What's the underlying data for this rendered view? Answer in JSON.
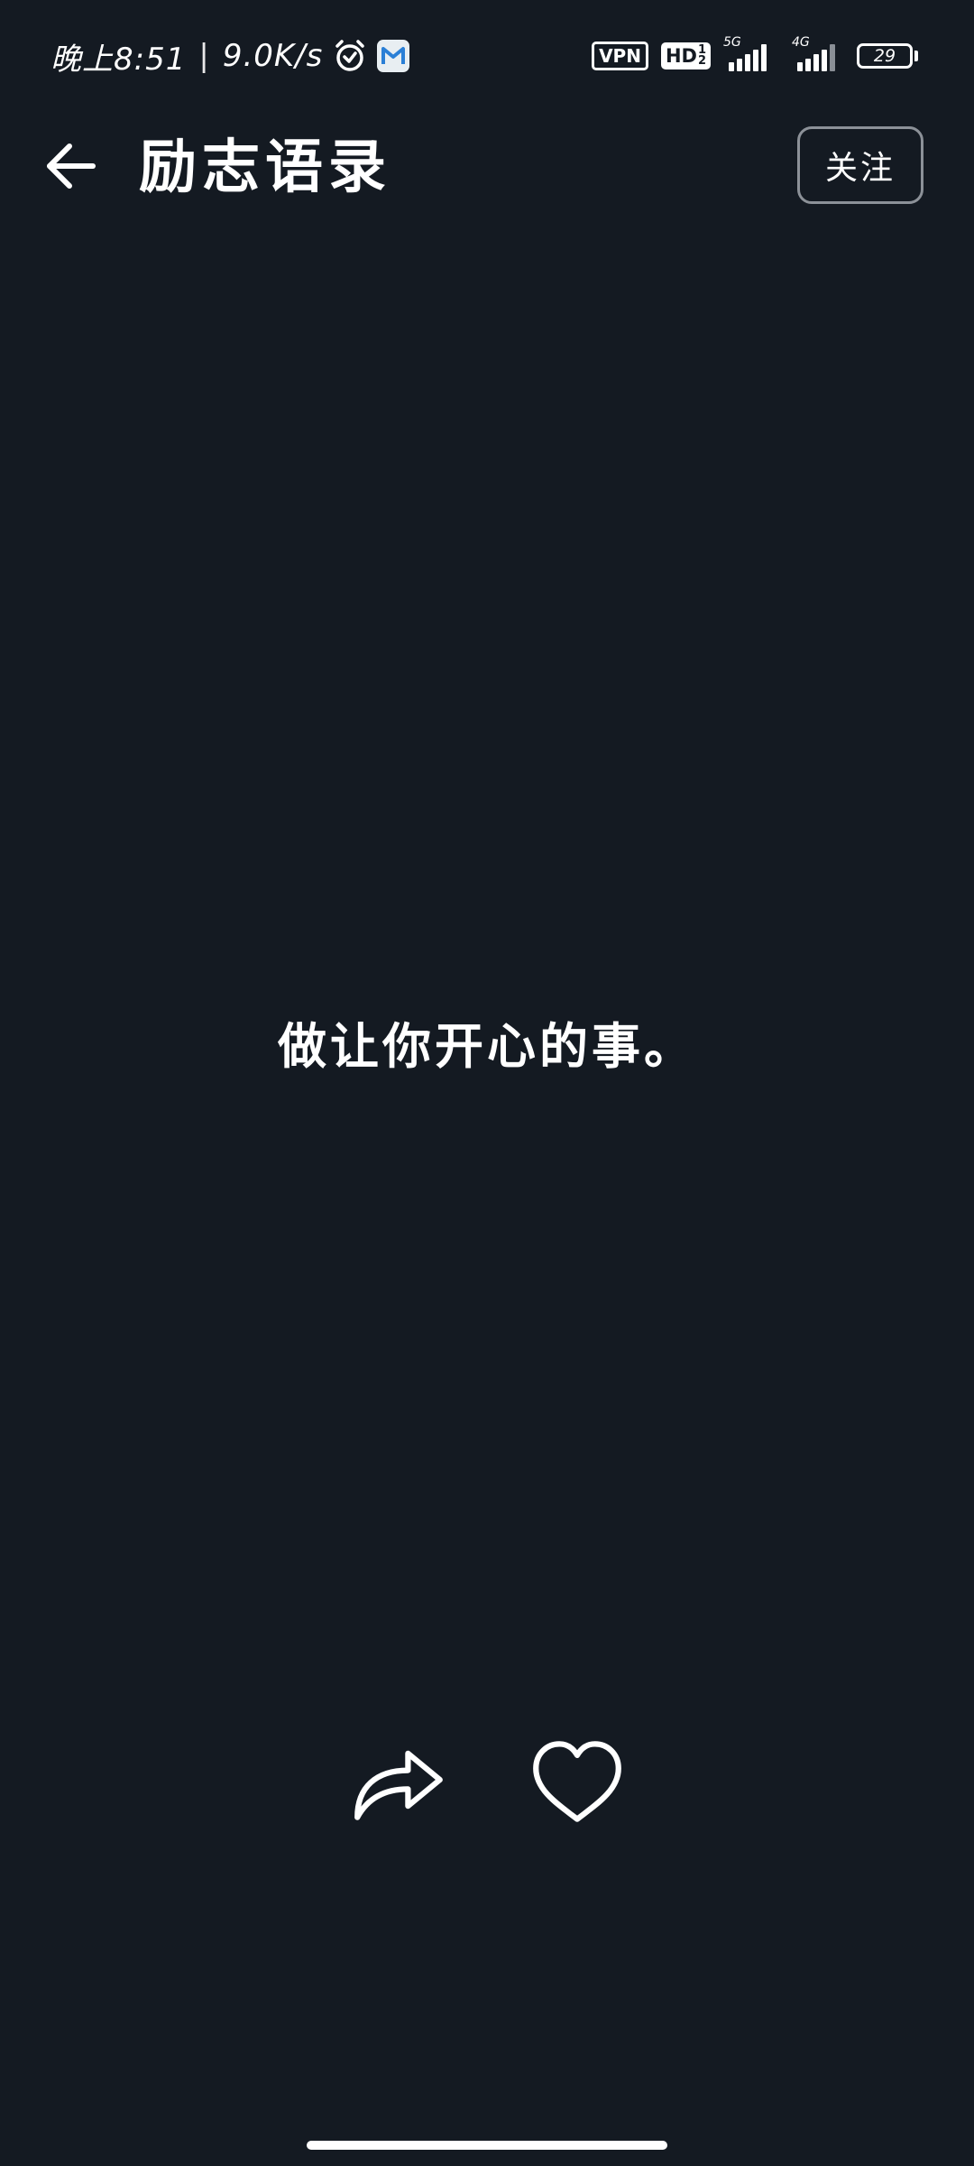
{
  "status_bar": {
    "time": "晚上8:51",
    "separator": "|",
    "net_speed": "9.0K/s",
    "alarm_icon": "alarm-clock-icon",
    "app_icon": "mail-app-icon",
    "vpn_label": "VPN",
    "hd_label": "HD",
    "hd_top": "1",
    "hd_bottom": "2",
    "signal1_tag": "5G",
    "signal2_tag": "4G",
    "battery_level": "29"
  },
  "header": {
    "back_icon": "arrow-left-icon",
    "title": "励志语录",
    "follow_label": "关注"
  },
  "quote": {
    "text": "做让你开心的事。"
  },
  "actions": {
    "share_icon": "share-arrow-icon",
    "like_icon": "heart-outline-icon"
  },
  "colors": {
    "background": "#141a22",
    "foreground": "#ffffff",
    "button_border": "#8c9198"
  }
}
